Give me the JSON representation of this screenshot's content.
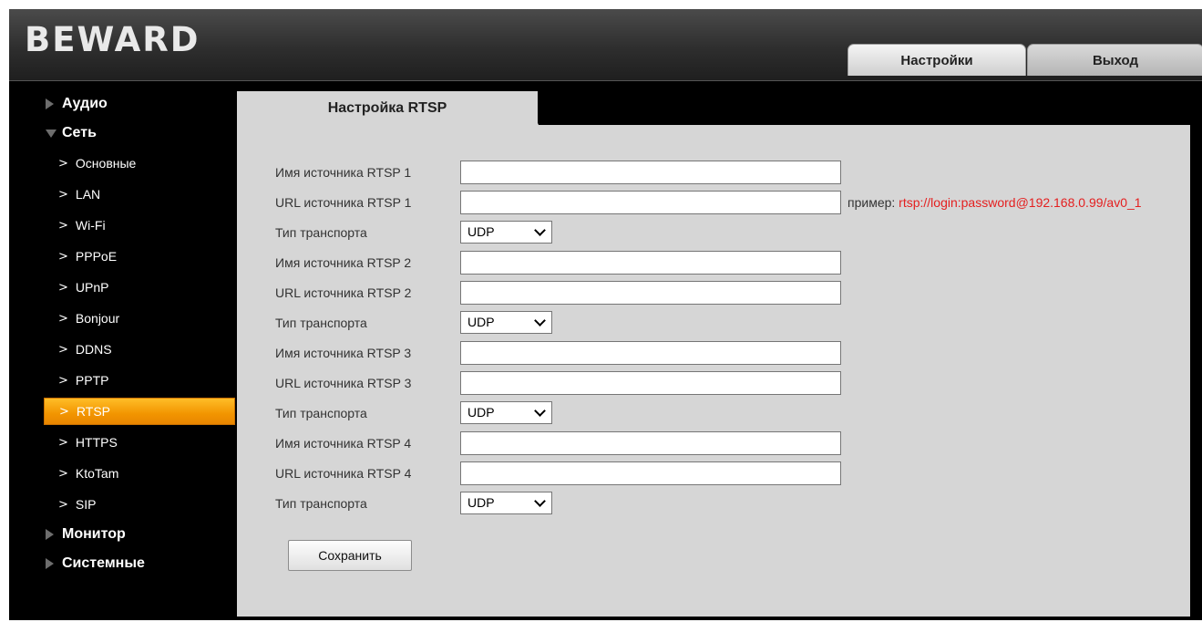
{
  "brand": {
    "logo_text": "BEWARD"
  },
  "top_tabs": {
    "settings": "Настройки",
    "exit": "Выход"
  },
  "sidebar": {
    "groups": [
      {
        "label": "Аудио"
      },
      {
        "label": "Сеть"
      },
      {
        "label": "Монитор"
      },
      {
        "label": "Системные"
      }
    ],
    "network_items": [
      {
        "label": "Основные"
      },
      {
        "label": "LAN"
      },
      {
        "label": "Wi-Fi"
      },
      {
        "label": "PPPoE"
      },
      {
        "label": "UPnP"
      },
      {
        "label": "Bonjour"
      },
      {
        "label": "DDNS"
      },
      {
        "label": "PPTP"
      },
      {
        "label": "RTSP"
      },
      {
        "label": "HTTPS"
      },
      {
        "label": "KtoTam"
      },
      {
        "label": "SIP"
      }
    ],
    "active_item": "RTSP",
    "accent_color": "#f29500"
  },
  "panel": {
    "title": "Настройка RTSP",
    "rows": [
      {
        "label": "Имя источника RTSP 1",
        "value": ""
      },
      {
        "label": "URL источника RTSP 1",
        "value": ""
      },
      {
        "label": "Тип транспорта",
        "value": "UDP"
      },
      {
        "label": "Имя источника RTSP 2",
        "value": ""
      },
      {
        "label": "URL источника RTSP 2",
        "value": ""
      },
      {
        "label": "Тип транспорта",
        "value": "UDP"
      },
      {
        "label": "Имя источника RTSP 3",
        "value": ""
      },
      {
        "label": "URL источника RTSP 3",
        "value": ""
      },
      {
        "label": "Тип транспорта",
        "value": "UDP"
      },
      {
        "label": "Имя источника RTSP 4",
        "value": ""
      },
      {
        "label": "URL источника RTSP 4",
        "value": ""
      },
      {
        "label": "Тип транспорта",
        "value": "UDP"
      }
    ],
    "hint_prefix": "пример: ",
    "hint_url": "rtsp://login:password@192.168.0.99/av0_1",
    "hint_url_color": "#e41f1f",
    "save_label": "Сохранить"
  }
}
